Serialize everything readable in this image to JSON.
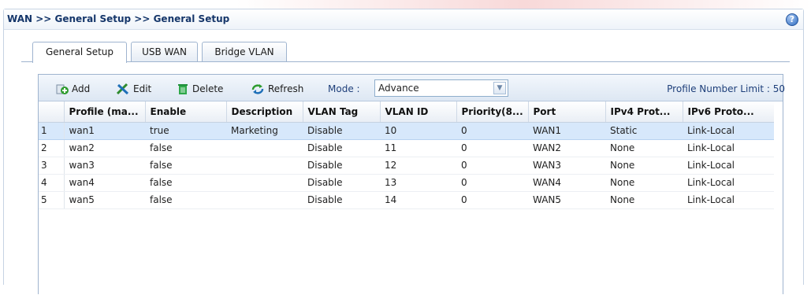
{
  "breadcrumb": "WAN >> General Setup >> General Setup",
  "help_icon": "?",
  "tabs": [
    {
      "label": "General Setup",
      "active": true
    },
    {
      "label": "USB WAN",
      "active": false
    },
    {
      "label": "Bridge VLAN",
      "active": false
    }
  ],
  "toolbar": {
    "add": "Add",
    "edit": "Edit",
    "delete": "Delete",
    "refresh": "Refresh",
    "mode_label": "Mode :",
    "mode_value": "Advance",
    "profile_limit": "Profile Number Limit : 50"
  },
  "columns": [
    "",
    "Profile (ma...",
    "Enable",
    "Description",
    "VLAN Tag",
    "VLAN ID",
    "Priority(8...",
    "Port",
    "IPv4 Prot...",
    "IPv6 Proto..."
  ],
  "rows": [
    [
      "1",
      "wan1",
      "true",
      "Marketing",
      "Disable",
      "10",
      "0",
      "WAN1",
      "Static",
      "Link-Local"
    ],
    [
      "2",
      "wan2",
      "false",
      "",
      "Disable",
      "11",
      "0",
      "WAN2",
      "None",
      "Link-Local"
    ],
    [
      "3",
      "wan3",
      "false",
      "",
      "Disable",
      "12",
      "0",
      "WAN3",
      "None",
      "Link-Local"
    ],
    [
      "4",
      "wan4",
      "false",
      "",
      "Disable",
      "13",
      "0",
      "WAN4",
      "None",
      "Link-Local"
    ],
    [
      "5",
      "wan5",
      "false",
      "",
      "Disable",
      "14",
      "0",
      "WAN5",
      "None",
      "Link-Local"
    ]
  ],
  "selected_row": 0,
  "icons": {
    "add": "add-plus-icon",
    "edit": "edit-tools-icon",
    "delete": "trash-icon",
    "refresh": "refresh-arrows-icon",
    "help": "help-question-icon"
  },
  "colors": {
    "title_text": "#15366a",
    "link_text": "#1e3f7a",
    "selected_row": "#d7e8fb",
    "add_green": "#2e9c2e",
    "delete_green": "#1f8f3a"
  }
}
